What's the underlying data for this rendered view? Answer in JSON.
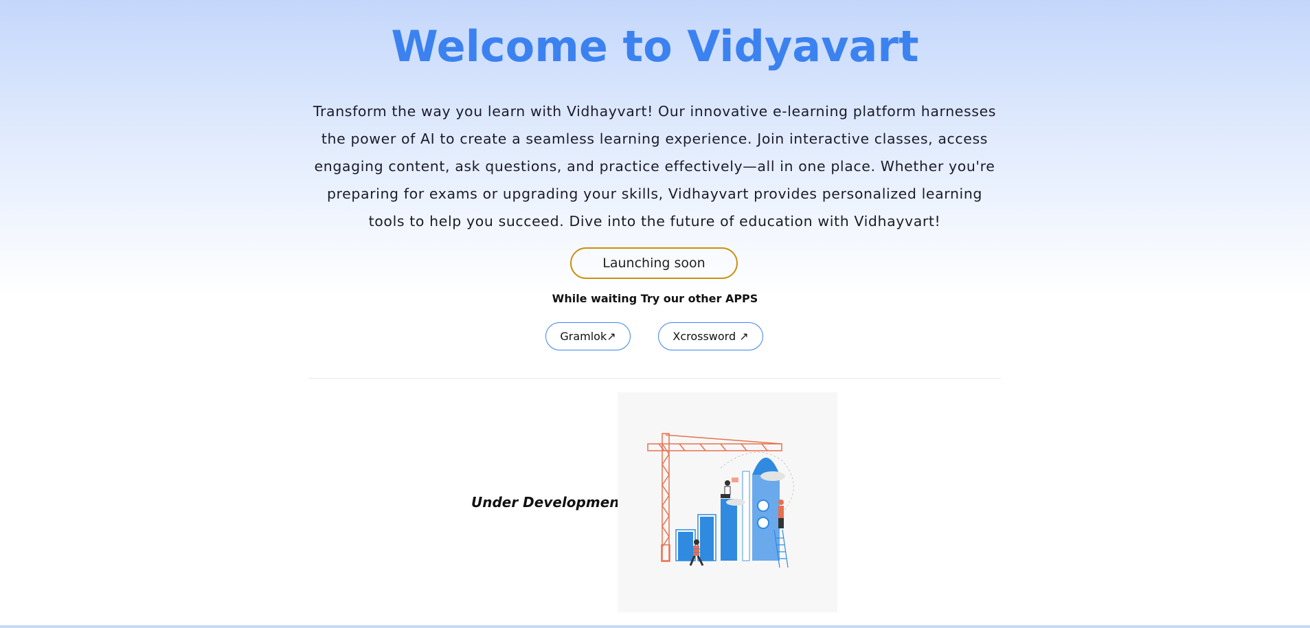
{
  "hero": {
    "title": "Welcome to Vidyavart",
    "description": "Transform the way you learn with Vidhayvart! Our innovative e-learning platform harnesses the power of AI to create a seamless learning experience. Join interactive classes, access engaging content, ask questions, and practice effectively—all in one place. Whether you're preparing for exams or upgrading your skills, Vidhayvart provides personalized learning tools to help you succeed. Dive into the future of education with Vidhayvart!",
    "launch_label": "Launching soon"
  },
  "apps": {
    "heading": "While waiting Try our other APPS",
    "items": [
      {
        "label": "Gramlok↗"
      },
      {
        "label": "Xcrossword ↗"
      }
    ]
  },
  "status": {
    "label": "Under Development",
    "illustration_icon": "construction-illustration-icon"
  },
  "colors": {
    "title": "#3b82f0",
    "launch_border": "#c9900f",
    "app_border": "#3b82f0",
    "illustration_orange": "#e8704f",
    "illustration_blue": "#2f8ae0"
  }
}
